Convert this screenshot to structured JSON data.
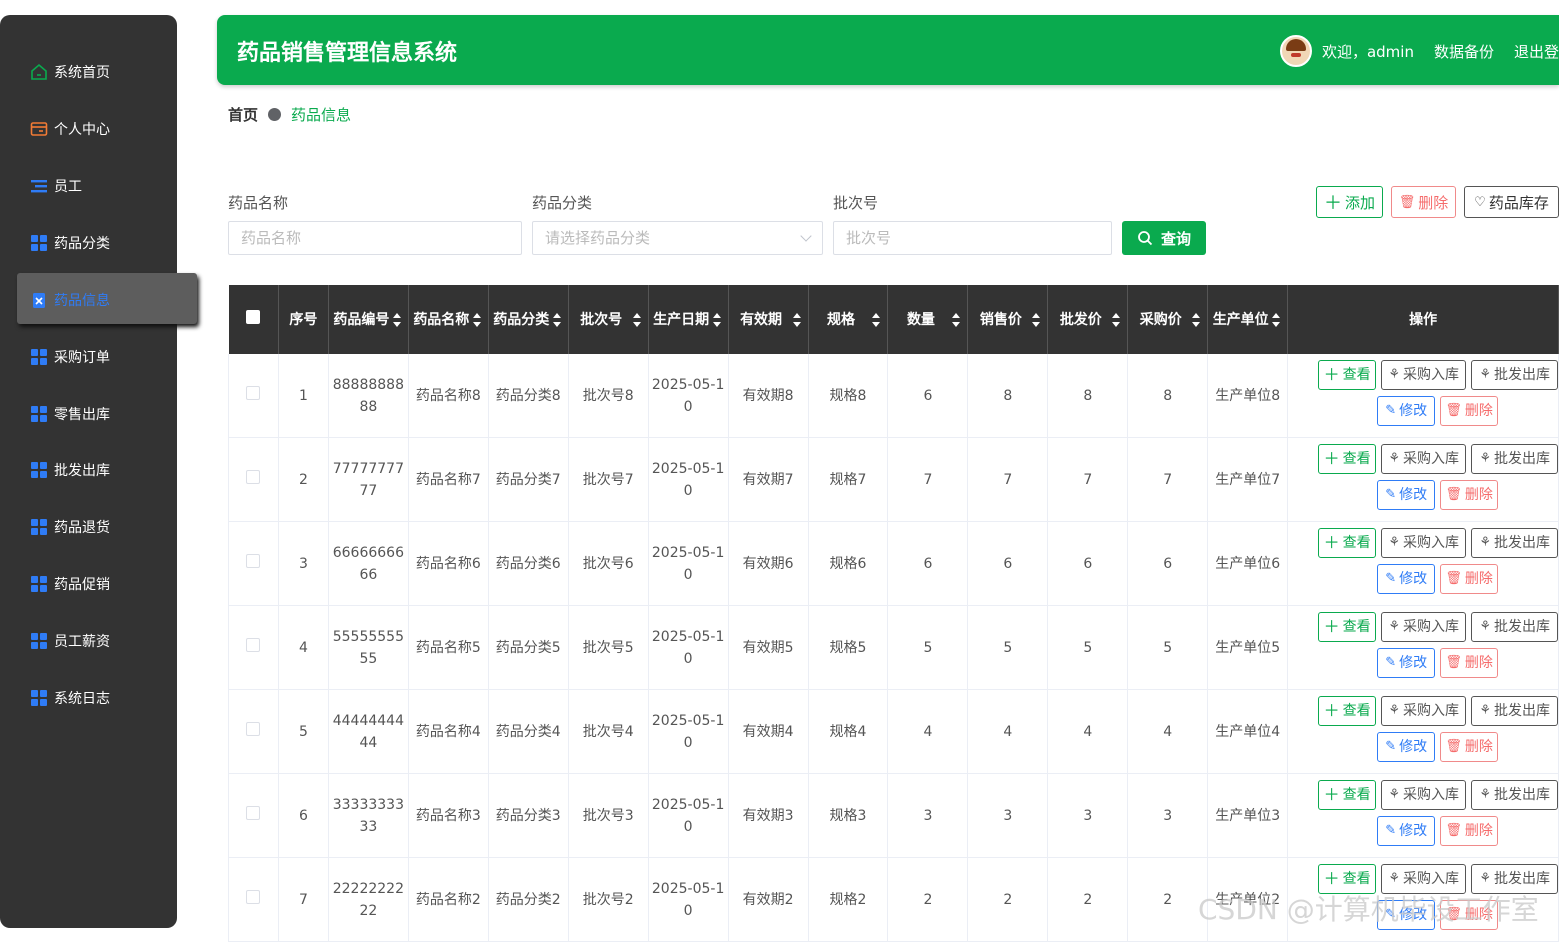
{
  "sidebar": {
    "items": [
      {
        "label": "系统首页",
        "icon": "home-icon",
        "color": "#0aaa4e"
      },
      {
        "label": "个人中心",
        "icon": "user-card-icon",
        "color": "#f27b35"
      },
      {
        "label": "员工",
        "icon": "list-icon",
        "color": "#2f7cf6"
      },
      {
        "label": "药品分类",
        "icon": "grid-icon",
        "color": "#2f7cf6"
      },
      {
        "label": "药品信息",
        "icon": "clipboard-icon",
        "color": "#2f7cf6",
        "active": true
      },
      {
        "label": "采购订单",
        "icon": "grid-icon",
        "color": "#2f7cf6"
      },
      {
        "label": "零售出库",
        "icon": "grid-icon",
        "color": "#2f7cf6"
      },
      {
        "label": "批发出库",
        "icon": "grid-icon",
        "color": "#2f7cf6"
      },
      {
        "label": "药品退货",
        "icon": "grid-icon",
        "color": "#2f7cf6"
      },
      {
        "label": "药品促销",
        "icon": "grid-icon",
        "color": "#2f7cf6"
      },
      {
        "label": "员工薪资",
        "icon": "grid-icon",
        "color": "#2f7cf6"
      },
      {
        "label": "系统日志",
        "icon": "grid-icon",
        "color": "#2f7cf6"
      }
    ]
  },
  "header": {
    "title": "药品销售管理信息系统",
    "welcome": "欢迎，admin",
    "backup": "数据备份",
    "logout": "退出登",
    "accent": "#0aaa4e"
  },
  "breadcrumb": {
    "home": "首页",
    "current": "药品信息"
  },
  "filters": {
    "name": {
      "label": "药品名称",
      "placeholder": "药品名称"
    },
    "category": {
      "label": "药品分类",
      "placeholder": "请选择药品分类"
    },
    "batch": {
      "label": "批次号",
      "placeholder": "批次号"
    },
    "query_label": "查询"
  },
  "toolbar": {
    "add": "添加",
    "delete": "删除",
    "stock": "药品库存"
  },
  "table": {
    "columns": [
      "序号",
      "药品编号",
      "药品名称",
      "药品分类",
      "批次号",
      "生产日期",
      "有效期",
      "规格",
      "数量",
      "销售价",
      "批发价",
      "采购价",
      "生产单位",
      "操作"
    ],
    "actions": {
      "view": "查看",
      "purchase_in": "采购入库",
      "wholesale_out": "批发出库",
      "edit": "修改",
      "delete": "删除"
    },
    "rows": [
      {
        "idx": "1",
        "code": "8888888888",
        "name": "药品名称8",
        "category": "药品分类8",
        "batch": "批次号8",
        "date": "2025-05-10",
        "expiry": "有效期8",
        "spec": "规格8",
        "qty": "6",
        "sale": "8",
        "wholesale": "8",
        "purchase": "8",
        "maker": "生产单位8"
      },
      {
        "idx": "2",
        "code": "7777777777",
        "name": "药品名称7",
        "category": "药品分类7",
        "batch": "批次号7",
        "date": "2025-05-10",
        "expiry": "有效期7",
        "spec": "规格7",
        "qty": "7",
        "sale": "7",
        "wholesale": "7",
        "purchase": "7",
        "maker": "生产单位7"
      },
      {
        "idx": "3",
        "code": "6666666666",
        "name": "药品名称6",
        "category": "药品分类6",
        "batch": "批次号6",
        "date": "2025-05-10",
        "expiry": "有效期6",
        "spec": "规格6",
        "qty": "6",
        "sale": "6",
        "wholesale": "6",
        "purchase": "6",
        "maker": "生产单位6"
      },
      {
        "idx": "4",
        "code": "5555555555",
        "name": "药品名称5",
        "category": "药品分类5",
        "batch": "批次号5",
        "date": "2025-05-10",
        "expiry": "有效期5",
        "spec": "规格5",
        "qty": "5",
        "sale": "5",
        "wholesale": "5",
        "purchase": "5",
        "maker": "生产单位5"
      },
      {
        "idx": "5",
        "code": "4444444444",
        "name": "药品名称4",
        "category": "药品分类4",
        "batch": "批次号4",
        "date": "2025-05-10",
        "expiry": "有效期4",
        "spec": "规格4",
        "qty": "4",
        "sale": "4",
        "wholesale": "4",
        "purchase": "4",
        "maker": "生产单位4"
      },
      {
        "idx": "6",
        "code": "3333333333",
        "name": "药品名称3",
        "category": "药品分类3",
        "batch": "批次号3",
        "date": "2025-05-10",
        "expiry": "有效期3",
        "spec": "规格3",
        "qty": "3",
        "sale": "3",
        "wholesale": "3",
        "purchase": "3",
        "maker": "生产单位3"
      },
      {
        "idx": "7",
        "code": "2222222222",
        "name": "药品名称2",
        "category": "药品分类2",
        "batch": "批次号2",
        "date": "2025-05-10",
        "expiry": "有效期2",
        "spec": "规格2",
        "qty": "2",
        "sale": "2",
        "wholesale": "2",
        "purchase": "2",
        "maker": "生产单位2"
      }
    ]
  },
  "watermark": "CSDN @计算机毕设工作室"
}
